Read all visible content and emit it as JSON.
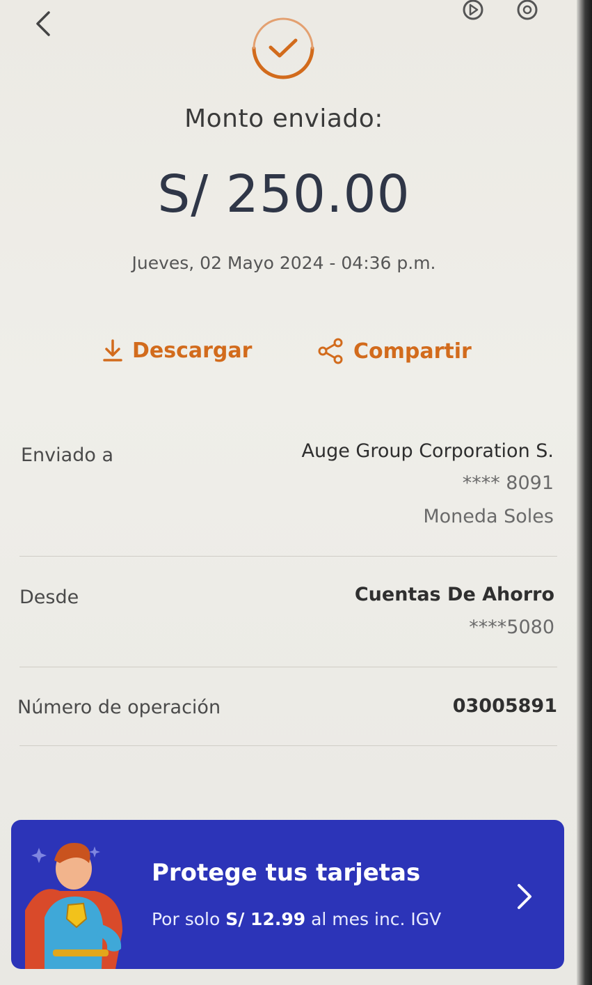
{
  "header": {
    "back_icon": "chevron-left-icon",
    "top_icons": [
      "play-badge-icon",
      "refresh-badge-icon"
    ],
    "success_icon": "check-circle-icon",
    "accent_color": "#d26b1c"
  },
  "summary": {
    "title": "Monto enviado:",
    "amount": "S/ 250.00",
    "datetime": "Jueves, 02 Mayo 2024 - 04:36 p.m."
  },
  "actions": {
    "download_label": "Descargar",
    "share_label": "Compartir"
  },
  "details": {
    "sent_to": {
      "label": "Enviado a",
      "name": "Auge Group Corporation S.",
      "account": "**** 8091",
      "currency": "Moneda Soles"
    },
    "from": {
      "label": "Desde",
      "account_type": "Cuentas De Ahorro",
      "account": "****5080"
    },
    "operation": {
      "label": "Número de operación",
      "number": "03005891"
    }
  },
  "banner": {
    "title": "Protege tus tarjetas",
    "sub_prefix": "Por solo ",
    "sub_price": "S/ 12.99",
    "sub_suffix": " al mes inc. IGV",
    "background_color": "#2c34b8"
  }
}
